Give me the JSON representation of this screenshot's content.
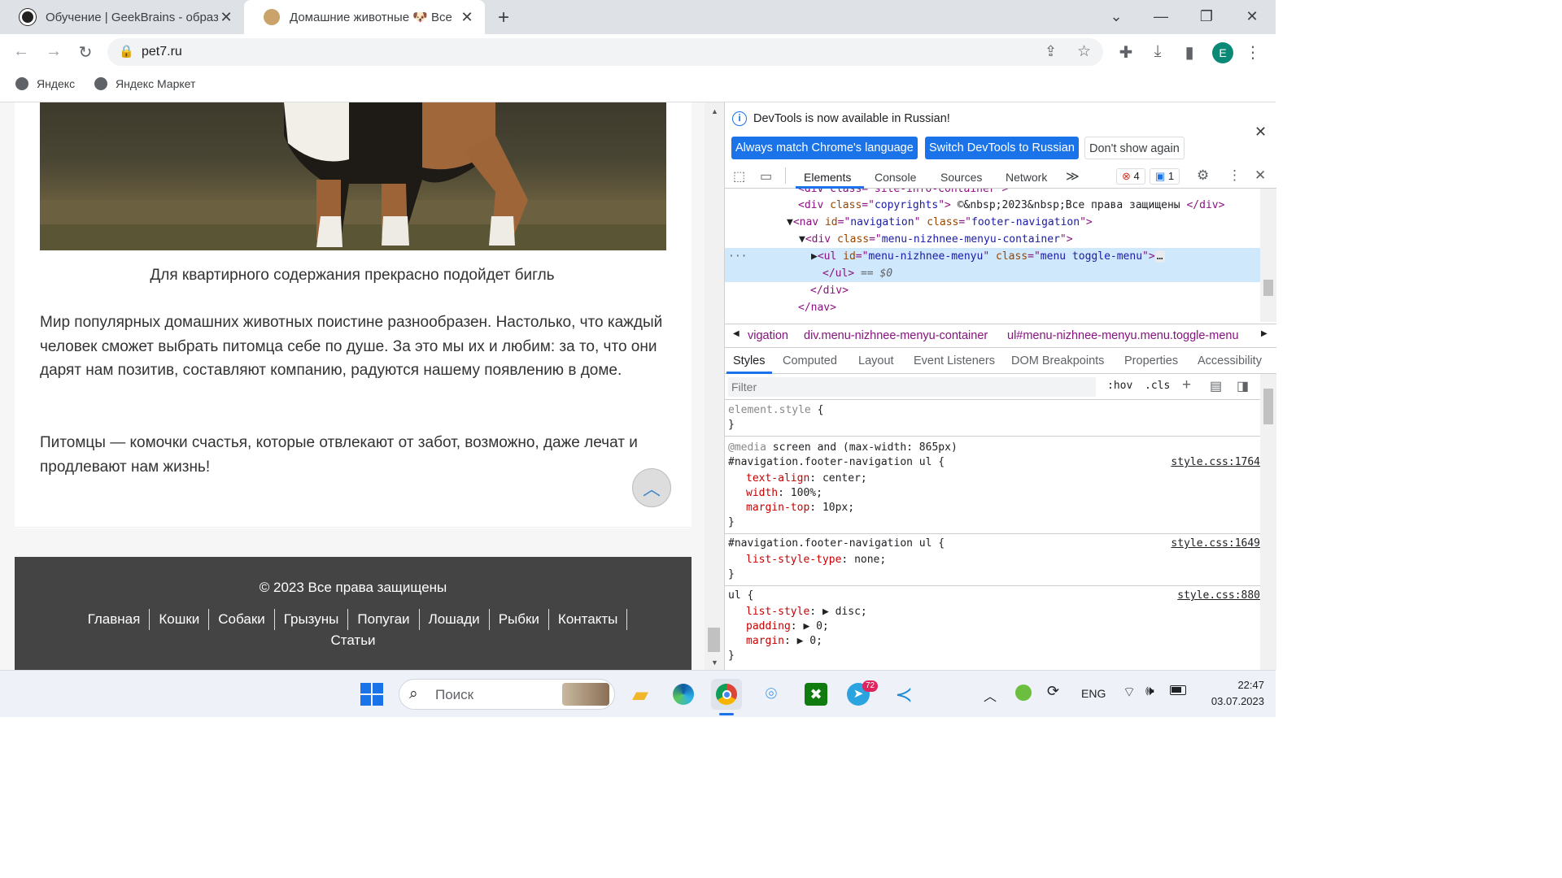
{
  "browser": {
    "tabs": [
      {
        "title": "Обучение | GeekBrains - образо",
        "active": false
      },
      {
        "title": "Домашние животные 🐶 Все пр",
        "active": true
      }
    ],
    "new_tab": "+",
    "url": "pet7.ru",
    "profile_initial": "E",
    "bookmarks": [
      "Яндекс",
      "Яндекс Маркет"
    ],
    "colors": {
      "accent": "#1a73e8",
      "profile": "#0a8a76"
    }
  },
  "page": {
    "caption": "Для квартирного содержания прекрасно подойдет бигль",
    "paragraph1": "Мир популярных домашних животных поистине разнообразен. Настолько, что каждый человек сможет выбрать питомца себе по душе. За это мы их и любим: за то, что они дарят нам позитив, составляют компанию, радуются нашему появлению в доме.",
    "paragraph2": "Питомцы — комочки счастья, которые отвлекают от забот, возможно, даже лечат и продлевают нам жизнь!",
    "footer_copyright": "© 2023 Все права защищены",
    "footer_nav": [
      "Главная",
      "Кошки",
      "Собаки",
      "Грызуны",
      "Попугаи",
      "Лошади",
      "Рыбки",
      "Контакты",
      "Статьи"
    ]
  },
  "devtools": {
    "banner_text": "DevTools is now available in Russian!",
    "banner_buttons": [
      "Always match Chrome's language",
      "Switch DevTools to Russian",
      "Don't show again"
    ],
    "tabs": [
      "Elements",
      "Console",
      "Sources",
      "Network"
    ],
    "errors_count": "4",
    "messages_count": "1",
    "dom_lines": [
      {
        "indent": 0,
        "html": "<div class=\"copyrights\"> ©&nbsp;2023&nbsp;Все права защищены </div>"
      },
      {
        "indent": 0,
        "html": "▼<nav id=\"navigation\" class=\"footer-navigation\">"
      },
      {
        "indent": 1,
        "html": "▼<div class=\"menu-nizhnee-menyu-container\">"
      },
      {
        "indent": 2,
        "html": "▶<ul id=\"menu-nizhnee-menyu\" class=\"menu toggle-menu\">…"
      },
      {
        "indent": 2,
        "html": "</ul> == $0"
      },
      {
        "indent": 1,
        "html": "</div>"
      },
      {
        "indent": 0,
        "html": "</nav>"
      }
    ],
    "breadcrumbs": [
      "vigation",
      "div.menu-nizhnee-menyu-container",
      "ul#menu-nizhnee-menyu.menu.toggle-menu"
    ],
    "styles_tabs": [
      "Styles",
      "Computed",
      "Layout",
      "Event Listeners",
      "DOM Breakpoints",
      "Properties",
      "Accessibility"
    ],
    "filter_placeholder": "Filter",
    "hov": ":hov",
    "cls": ".cls",
    "rules": [
      {
        "selector": "element.style {",
        "props": [],
        "source": ""
      },
      {
        "media": "@media screen and (max-width: 865px)",
        "selector": "#navigation.footer-navigation ul {",
        "props": [
          [
            "text-align",
            "center;"
          ],
          [
            "width",
            "100%;"
          ],
          [
            "margin-top",
            "10px;"
          ]
        ],
        "source": "style.css:1764"
      },
      {
        "selector": "#navigation.footer-navigation ul {",
        "props": [
          [
            "list-style-type",
            "none;"
          ]
        ],
        "source": "style.css:1649"
      },
      {
        "selector": "ul {",
        "props": [
          [
            "list-style",
            "▶ disc;"
          ],
          [
            "padding",
            "▶ 0;"
          ],
          [
            "margin",
            "▶ 0;"
          ]
        ],
        "source": "style.css:880"
      }
    ]
  },
  "taskbar": {
    "search_placeholder": "Поиск",
    "language": "ENG",
    "time": "22:47",
    "date": "03.07.2023",
    "telegram_badge": "72"
  }
}
